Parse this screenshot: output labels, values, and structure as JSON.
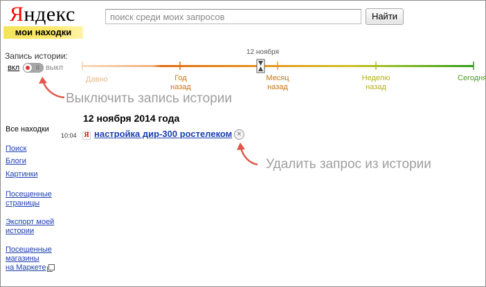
{
  "logo": {
    "first_letter": "Я",
    "rest": "ндекс"
  },
  "subtitle": "мои находки",
  "search": {
    "placeholder": "поиск среди моих запросов",
    "button_label": "Найти"
  },
  "history": {
    "label": "Запись истории:",
    "on_label": "вкл",
    "off_label": "выкл",
    "switch_mark": "II"
  },
  "timeline": {
    "current_marker_label": "12 ноября",
    "labels": [
      {
        "line1": "Давно",
        "line2": ""
      },
      {
        "line1": "Год",
        "line2": "назад"
      },
      {
        "line1": "Месяц",
        "line2": "назад"
      },
      {
        "line1": "Неделю",
        "line2": "назад"
      },
      {
        "line1": "Сегодня",
        "line2": ""
      }
    ],
    "colors": {
      "faded": "#f6cda6",
      "orange": "#e06a10",
      "yellow": "#cfc020",
      "green": "#2e9b14"
    }
  },
  "annotations": {
    "toggle_hint": "Выключить запись истории",
    "delete_hint": "Удалить запрос из истории",
    "arrow_color": "#e0574a"
  },
  "sidebar": {
    "all_label": "Все находки",
    "items": [
      {
        "label": "Поиск"
      },
      {
        "label": "Блоги"
      },
      {
        "label": "Картинки"
      },
      {
        "line1": "Посещенные",
        "line2": "страницы"
      },
      {
        "line1": "Экспорт моей",
        "line2": "истории"
      },
      {
        "line1": "Посещенные",
        "line2": "магазины",
        "line3": "на Маркете"
      }
    ]
  },
  "results": {
    "date_heading": "12 ноября 2014 года",
    "items": [
      {
        "time": "10:04",
        "favicon": "Я",
        "title": "настройка дир-300 ростелеком",
        "delete_icon": "×"
      }
    ]
  }
}
